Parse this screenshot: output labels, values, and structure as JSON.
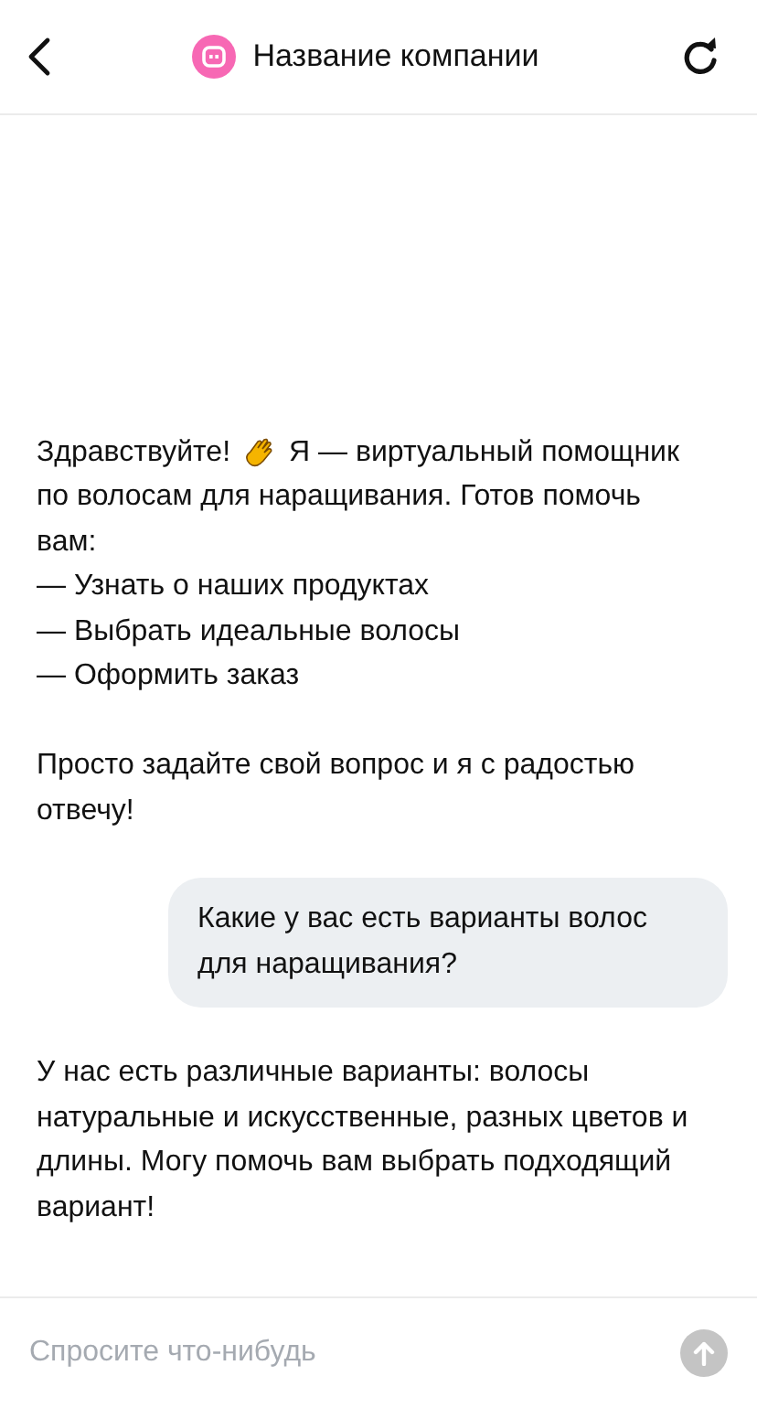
{
  "header": {
    "title": "Название компании"
  },
  "messages": [
    {
      "kind": "bot",
      "greeting": "Здравствуйте!",
      "greeting_rest": "Я — виртуальный помощник",
      "text": "по волосам для наращивания. Готов помочь вам:\n— Узнать о наших продуктах\n— Выбрать идеальные волосы\n— Оформить заказ\n\nПросто задайте свой вопрос и я с радостью отвечу!"
    },
    {
      "kind": "user",
      "text": "Какие у вас есть варианты волос для наращивания?"
    },
    {
      "kind": "bot",
      "text": "У нас есть различные варианты: волосы натуральные и искусственные, разных цветов и длины. Могу помочь вам выбрать подходящий вариант!"
    }
  ],
  "input": {
    "placeholder": "Спросите что-нибудь"
  }
}
